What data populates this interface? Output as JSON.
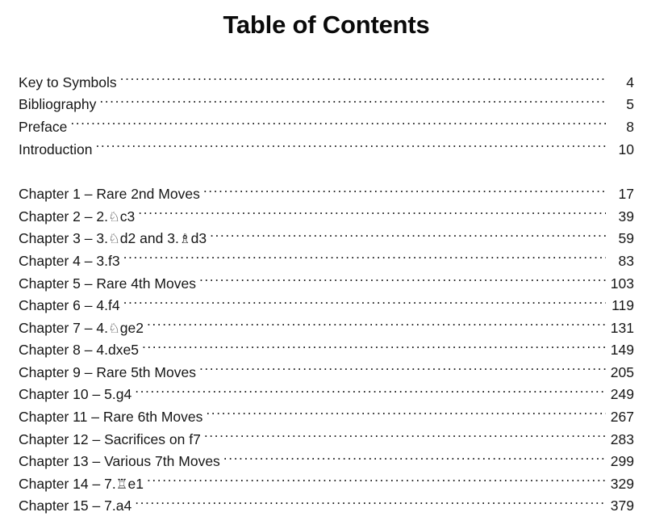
{
  "document": {
    "title": "Table of Contents",
    "leader_char": "."
  },
  "front_matter": [
    {
      "label": "Key to Symbols",
      "page": "4"
    },
    {
      "label": "Bibliography",
      "page": "5"
    },
    {
      "label": "Preface",
      "page": "8"
    },
    {
      "label": "Introduction",
      "page": "10"
    }
  ],
  "chapters": [
    {
      "label": "Chapter 1 – Rare 2nd Moves",
      "page": "17"
    },
    {
      "label": "Chapter 2 – 2.♘c3",
      "page": "39"
    },
    {
      "label": "Chapter 3 – 3.♘d2 and 3.♗d3",
      "page": "59"
    },
    {
      "label": "Chapter 4 – 3.f3",
      "page": "83"
    },
    {
      "label": "Chapter 5 – Rare 4th Moves",
      "page": "103"
    },
    {
      "label": "Chapter 6 – 4.f4",
      "page": "119"
    },
    {
      "label": "Chapter 7 – 4.♘ge2",
      "page": "131"
    },
    {
      "label": "Chapter 8 – 4.dxe5",
      "page": "149"
    },
    {
      "label": "Chapter 9 – Rare 5th Moves",
      "page": "205"
    },
    {
      "label": "Chapter 10 – 5.g4",
      "page": "249"
    },
    {
      "label": "Chapter 11 – Rare 6th Moves",
      "page": "267"
    },
    {
      "label": "Chapter 12 – Sacrifices on f7",
      "page": "283"
    },
    {
      "label": "Chapter 13 – Various 7th Moves",
      "page": "299"
    },
    {
      "label": "Chapter 14 – 7.♖e1",
      "page": "329"
    },
    {
      "label": "Chapter 15 – 7.a4",
      "page": "379"
    }
  ],
  "colors": {
    "text": "#161616",
    "background": "#ffffff"
  }
}
